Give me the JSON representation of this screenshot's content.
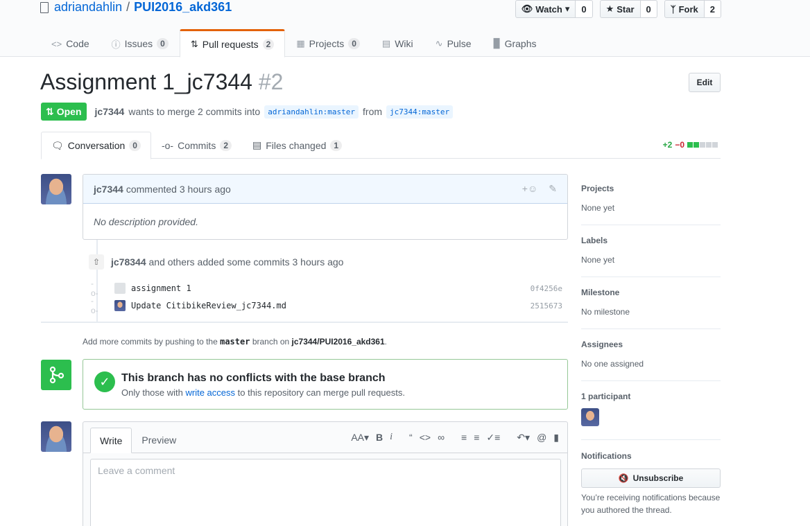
{
  "repo": {
    "owner": "adriandahlin",
    "separator": "/",
    "name": "PUI2016_akd361"
  },
  "actions": {
    "watch_label": "Watch",
    "watch_count": "0",
    "star_label": "Star",
    "star_count": "0",
    "fork_label": "Fork",
    "fork_count": "2"
  },
  "reponav": {
    "code": "Code",
    "issues": "Issues",
    "issues_count": "0",
    "pulls": "Pull requests",
    "pulls_count": "2",
    "projects": "Projects",
    "projects_count": "0",
    "wiki": "Wiki",
    "pulse": "Pulse",
    "graphs": "Graphs"
  },
  "pr": {
    "title": "Assignment 1_jc7344",
    "number": "#2",
    "edit_label": "Edit",
    "state": "Open",
    "author": "jc7344",
    "merge_text": "wants to merge 2 commits into",
    "base_branch": "adriandahlin:master",
    "from_text": "from",
    "head_branch": "jc7344:master"
  },
  "tabs": {
    "conversation": "Conversation",
    "conversation_count": "0",
    "commits": "Commits",
    "commits_count": "2",
    "files": "Files changed",
    "files_count": "1",
    "additions": "+2",
    "deletions": "−0"
  },
  "comment": {
    "author": "jc7344",
    "action": "commented 3 hours ago",
    "body": "No description provided."
  },
  "commits": {
    "author": "jc78344",
    "text": "and others added some commits 3 hours ago",
    "items": [
      {
        "message": "assignment 1",
        "sha": "0f4256e"
      },
      {
        "message": "Update CitibikeReview_jc7344.md",
        "sha": "2515673"
      }
    ]
  },
  "push_hint": {
    "prefix": "Add more commits by pushing to the",
    "branch": "master",
    "middle": "branch on",
    "repo": "jc7344/PUI2016_akd361",
    "suffix": "."
  },
  "merge": {
    "title": "This branch has no conflicts with the base branch",
    "sub_prefix": "Only those with",
    "sub_link": "write access",
    "sub_suffix": "to this repository can merge pull requests."
  },
  "new_comment": {
    "write_tab": "Write",
    "preview_tab": "Preview",
    "placeholder": "Leave a comment"
  },
  "sidebar": {
    "projects_heading": "Projects",
    "projects_value": "None yet",
    "labels_heading": "Labels",
    "labels_value": "None yet",
    "milestone_heading": "Milestone",
    "milestone_value": "No milestone",
    "assignees_heading": "Assignees",
    "assignees_value": "No one assigned",
    "participants_heading": "1 participant",
    "notifications_heading": "Notifications",
    "unsubscribe_label": "Unsubscribe",
    "notify_note": "You’re receiving notifications because you authored the thread."
  },
  "colors": {
    "accent": "#0366d6",
    "open": "#2cbe4e",
    "tab_highlight": "#e36209"
  }
}
